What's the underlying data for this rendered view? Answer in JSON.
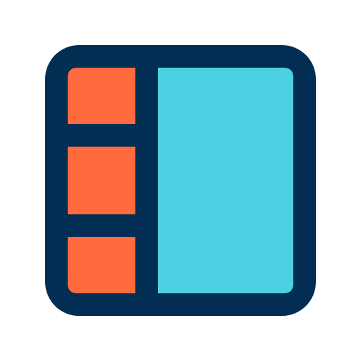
{
  "icon": {
    "name": "sidebar-layout-icon",
    "colors": {
      "frame": "#032E54",
      "sidebar_cells": "#FF6B3E",
      "main_panel": "#4CD1E3",
      "background": "#FFFFFF"
    },
    "sidebar_cell_count": 3
  }
}
